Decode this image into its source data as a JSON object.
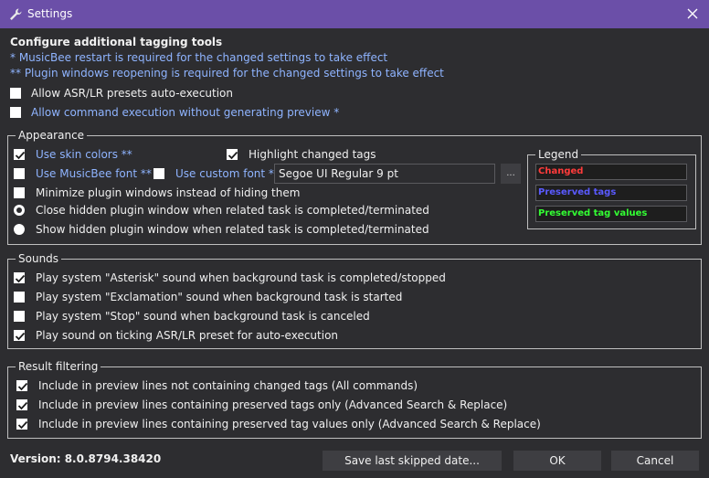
{
  "window": {
    "title": "Settings",
    "title_icon": "wrench-icon",
    "close_icon": "close-icon"
  },
  "header": {
    "heading": "Configure additional tagging tools",
    "note1": "*  MusicBee restart  is required for the changed settings to take effect",
    "note2": "**  Plugin windows reopening is required for the changed settings to take effect"
  },
  "top_options": {
    "asr_autoexec": {
      "label": "Allow ASR/LR presets auto-execution",
      "checked": false
    },
    "cmd_no_preview": {
      "label": "Allow command execution without generating preview *",
      "checked": false
    }
  },
  "appearance": {
    "group_label": "Appearance",
    "use_skin_colors": {
      "label": "Use skin colors **",
      "checked": true
    },
    "highlight_changed": {
      "label": "Highlight changed tags",
      "checked": true
    },
    "use_musicbee_font": {
      "label": "Use MusicBee font **",
      "checked": false
    },
    "use_custom_font": {
      "label": "Use custom font **",
      "checked": false
    },
    "font_value": "Segoe UI Regular 9 pt",
    "font_browse_label": "...",
    "minimize_windows": {
      "label": "Minimize plugin windows instead of hiding them",
      "checked": false
    },
    "close_hidden": {
      "label": "Close hidden plugin window when related task is completed/terminated",
      "selected": true
    },
    "show_hidden": {
      "label": "Show hidden plugin window when related task is completed/terminated",
      "selected": false
    }
  },
  "legend": {
    "group_label": "Legend",
    "items": [
      {
        "label": "Changed",
        "color": "#ff3b3b"
      },
      {
        "label": "Preserved tags",
        "color": "#5a5aff"
      },
      {
        "label": "Preserved tag values",
        "color": "#33ff33"
      }
    ]
  },
  "sounds": {
    "group_label": "Sounds",
    "items": [
      {
        "label": "Play system \"Asterisk\" sound when background task is completed/stopped",
        "checked": true
      },
      {
        "label": "Play system \"Exclamation\" sound when background task is started",
        "checked": false
      },
      {
        "label": "Play system \"Stop\" sound when background task is canceled",
        "checked": false
      },
      {
        "label": "Play sound on ticking ASR/LR preset for auto-execution",
        "checked": true
      }
    ]
  },
  "result_filtering": {
    "group_label": "Result filtering",
    "items": [
      {
        "label": "Include in preview lines not containing changed tags (All commands)",
        "checked": true
      },
      {
        "label": "Include in preview lines containing preserved tags only (Advanced Search & Replace)",
        "checked": true
      },
      {
        "label": "Include in preview lines containing preserved tag values only (Advanced Search & Replace)",
        "checked": true
      }
    ]
  },
  "footer": {
    "version": "Version: 8.0.8794.38420",
    "save_skipped_label": "Save last skipped date...",
    "ok_label": "OK",
    "cancel_label": "Cancel"
  },
  "colors": {
    "titlebar": "#6b4fa8",
    "background": "#2d2d30",
    "link_text": "#8fb4ff",
    "button": "#3e3e42"
  }
}
